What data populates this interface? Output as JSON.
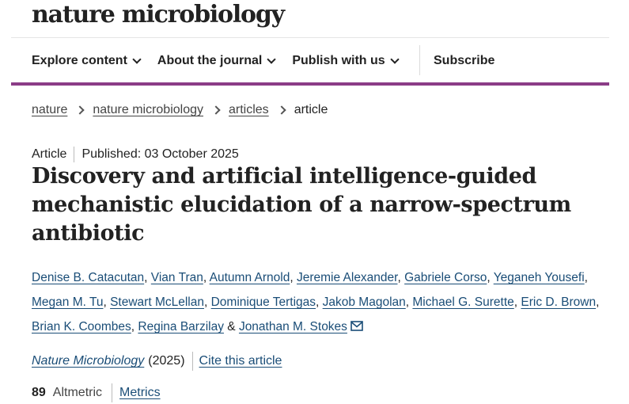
{
  "header": {
    "logo": "nature microbiology"
  },
  "nav": {
    "items": [
      {
        "label": "Explore content"
      },
      {
        "label": "About the journal"
      },
      {
        "label": "Publish with us"
      }
    ],
    "subscribe": "Subscribe",
    "accent_color": "#8b3c87"
  },
  "breadcrumb": [
    "nature",
    "nature microbiology",
    "articles",
    "article"
  ],
  "article": {
    "type": "Article",
    "published": "Published: 03 October 2025",
    "title": "Discovery and artificial intelligence-guided mechanistic elucidation of a narrow-spectrum antibiotic",
    "authors": [
      "Denise B. Catacutan",
      "Vian Tran",
      "Autumn Arnold",
      "Jeremie Alexander",
      "Gabriele Corso",
      "Yeganeh Yousefi",
      "Megan M. Tu",
      "Stewart McLellan",
      "Dominique Tertigas",
      "Jakob Magolan",
      "Michael G. Surette",
      "Eric D. Brown",
      "Brian K. Coombes",
      "Regina Barzilay",
      "Jonathan M. Stokes"
    ],
    "and_text": "&",
    "journal": "Nature Microbiology",
    "year": "(2025)",
    "cite_label": "Cite this article",
    "altmetric_score": "89",
    "altmetric_label": "Altmetric",
    "metrics_label": "Metrics",
    "link_color": "#1a4d77"
  }
}
